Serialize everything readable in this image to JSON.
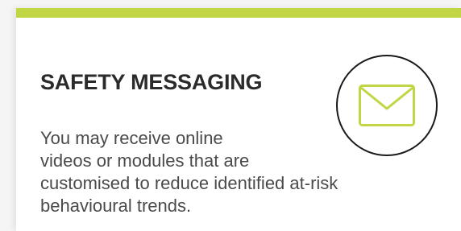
{
  "card": {
    "accent_color": "#c2d545",
    "title": "SAFETY MESSAGING",
    "icon": "envelope-icon",
    "body_lines": [
      "You may receive online",
      "videos or modules that are",
      "customised to reduce identified at-risk",
      "behavioural trends."
    ]
  }
}
